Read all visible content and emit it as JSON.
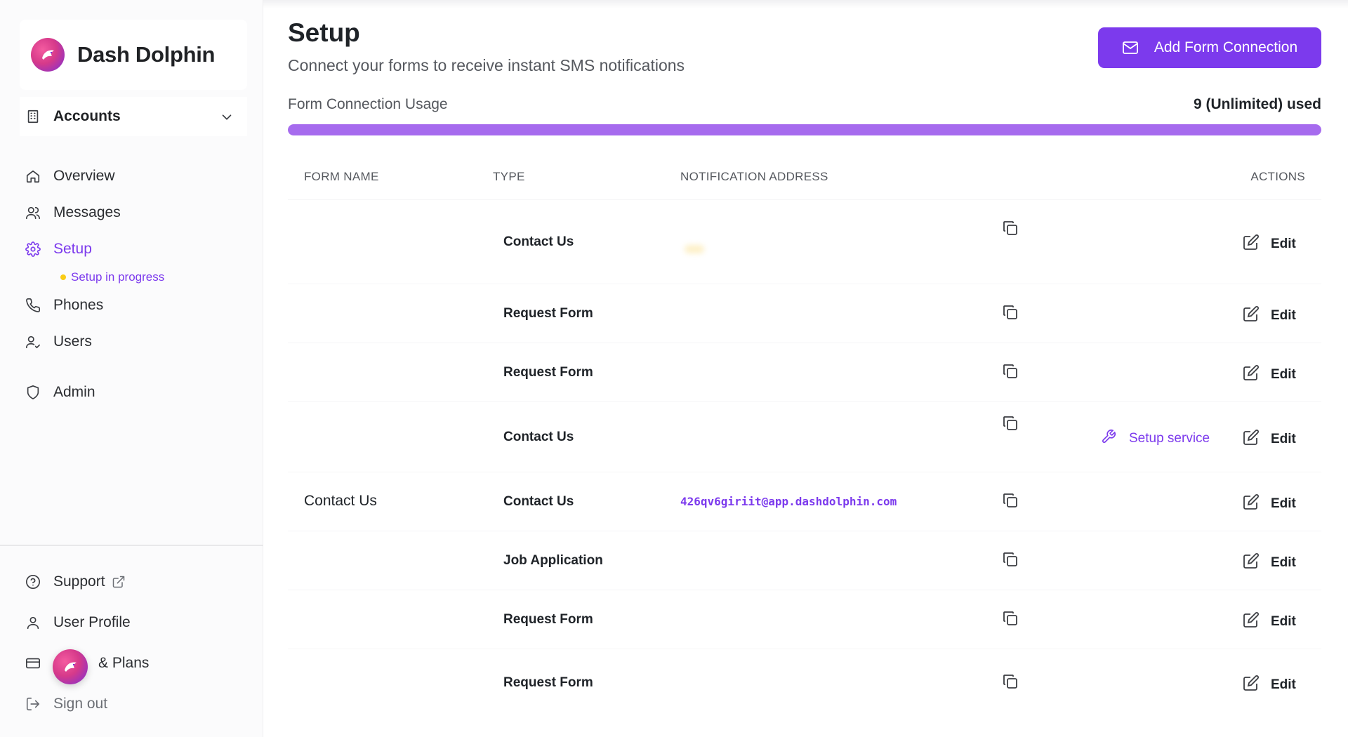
{
  "brand": {
    "name": "Dash Dolphin"
  },
  "sidebar": {
    "accounts_label": "Accounts",
    "items": [
      {
        "label": "Overview",
        "icon": "home-icon"
      },
      {
        "label": "Messages",
        "icon": "users-icon"
      },
      {
        "label": "Setup",
        "icon": "gear-icon",
        "active": true,
        "sub": "Setup in progress"
      },
      {
        "label": "Phones",
        "icon": "phone-icon"
      },
      {
        "label": "Users",
        "icon": "user-check-icon"
      },
      {
        "label": "Admin",
        "icon": "shield-icon"
      }
    ],
    "bottom": [
      {
        "label": "Support",
        "icon": "help-circle-icon",
        "external": true
      },
      {
        "label": "User Profile",
        "icon": "user-icon"
      },
      {
        "label": "& Plans",
        "icon": "credit-card-icon"
      },
      {
        "label": "Sign out",
        "icon": "sign-out-icon"
      }
    ]
  },
  "header": {
    "title": "Setup",
    "subtitle": "Connect your forms to receive instant SMS notifications",
    "add_button": "Add Form Connection"
  },
  "usage": {
    "label": "Form Connection Usage",
    "count": "9 (Unlimited) used",
    "fill_fraction": 1.0
  },
  "table": {
    "headers": {
      "name": "FORM NAME",
      "type": "TYPE",
      "address": "NOTIFICATION ADDRESS",
      "actions": "ACTIONS"
    },
    "edit_label": "Edit",
    "setup_service_label": "Setup service",
    "rows": [
      {
        "name": "",
        "type": "Contact Us",
        "address": "",
        "badge": "",
        "blurred": true
      },
      {
        "name": "",
        "type": "Request Form",
        "address": "",
        "blurred": true
      },
      {
        "name": "",
        "type": "Request Form",
        "address": "",
        "blurred": true
      },
      {
        "name": "",
        "type": "Contact Us",
        "address": "",
        "note": "",
        "blurred": true,
        "setup_service": true
      },
      {
        "name": "Contact Us",
        "type": "Contact Us",
        "address": "426qv6giriit@app.dashdolphin.com",
        "blurred": false
      },
      {
        "name": "",
        "type": "Job Application",
        "address": "",
        "blurred": true
      },
      {
        "name": "",
        "type": "Request Form",
        "address": "",
        "blurred": true
      },
      {
        "name": "",
        "type": "Request Form",
        "address": "",
        "blurred": true
      }
    ]
  },
  "colors": {
    "accent": "#7c3aed",
    "bar": "#a66bee",
    "badge": "#fdf0c8"
  }
}
